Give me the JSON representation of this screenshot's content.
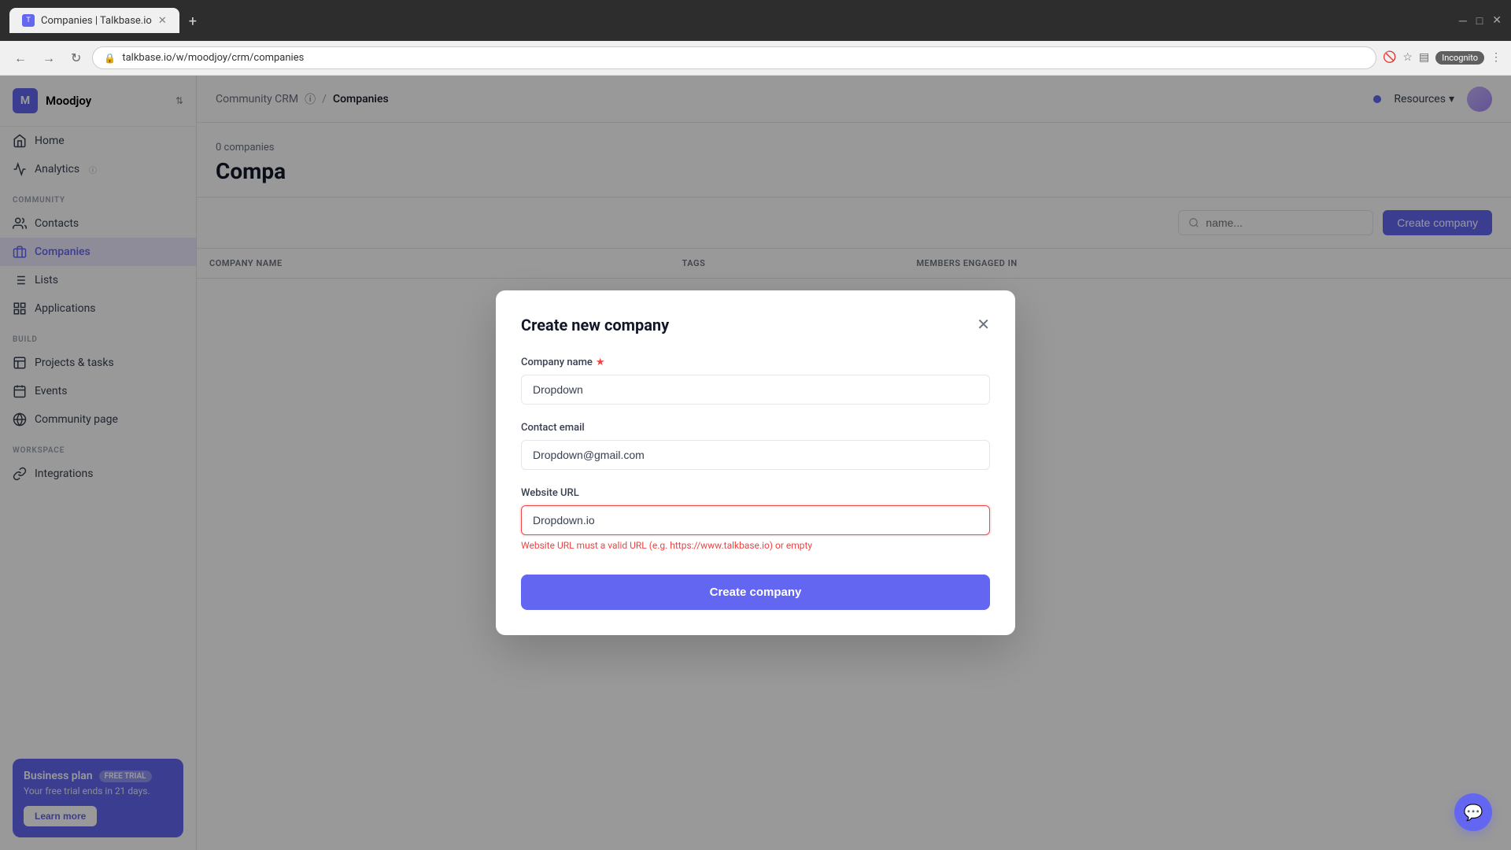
{
  "browser": {
    "tab_title": "Companies | Talkbase.io",
    "tab_icon": "T",
    "url": "talkbase.io/w/moodjoy/crm/companies",
    "incognito_label": "Incognito"
  },
  "sidebar": {
    "workspace_letter": "M",
    "workspace_name": "Moodjoy",
    "nav": {
      "home_label": "Home",
      "analytics_label": "Analytics",
      "community_section": "COMMUNITY",
      "contacts_label": "Contacts",
      "companies_label": "Companies",
      "lists_label": "Lists",
      "applications_label": "Applications",
      "build_section": "BUILD",
      "projects_label": "Projects & tasks",
      "events_label": "Events",
      "community_page_label": "Community page",
      "workspace_section": "WORKSPACE",
      "integrations_label": "Integrations"
    },
    "plan_card": {
      "title": "Business plan",
      "badge": "FREE TRIAL",
      "subtitle": "Your free trial ends in 21 days.",
      "btn_label": "Learn more"
    }
  },
  "topbar": {
    "breadcrumb_parent": "Community CRM",
    "breadcrumb_separator": "/",
    "breadcrumb_current": "Companies",
    "resources_label": "Resources",
    "info_symbol": "ⓘ"
  },
  "page": {
    "count_label": "0 companies",
    "title": "Compa",
    "search_placeholder": "name...",
    "create_btn_label": "Create company"
  },
  "table": {
    "columns": [
      "COMPANY NAME",
      "TAGS",
      "MEMBERS ENGAGED IN"
    ]
  },
  "modal": {
    "title": "Create new company",
    "company_name_label": "Company name",
    "company_name_required": true,
    "company_name_value": "Dropdown",
    "contact_email_label": "Contact email",
    "contact_email_value": "Dropdown@gmail.com",
    "website_url_label": "Website URL",
    "website_url_value": "Dropdown.io",
    "website_error": "Website URL must a valid URL (e.g. https://www.talkbase.io) or empty",
    "create_btn_label": "Create company"
  }
}
